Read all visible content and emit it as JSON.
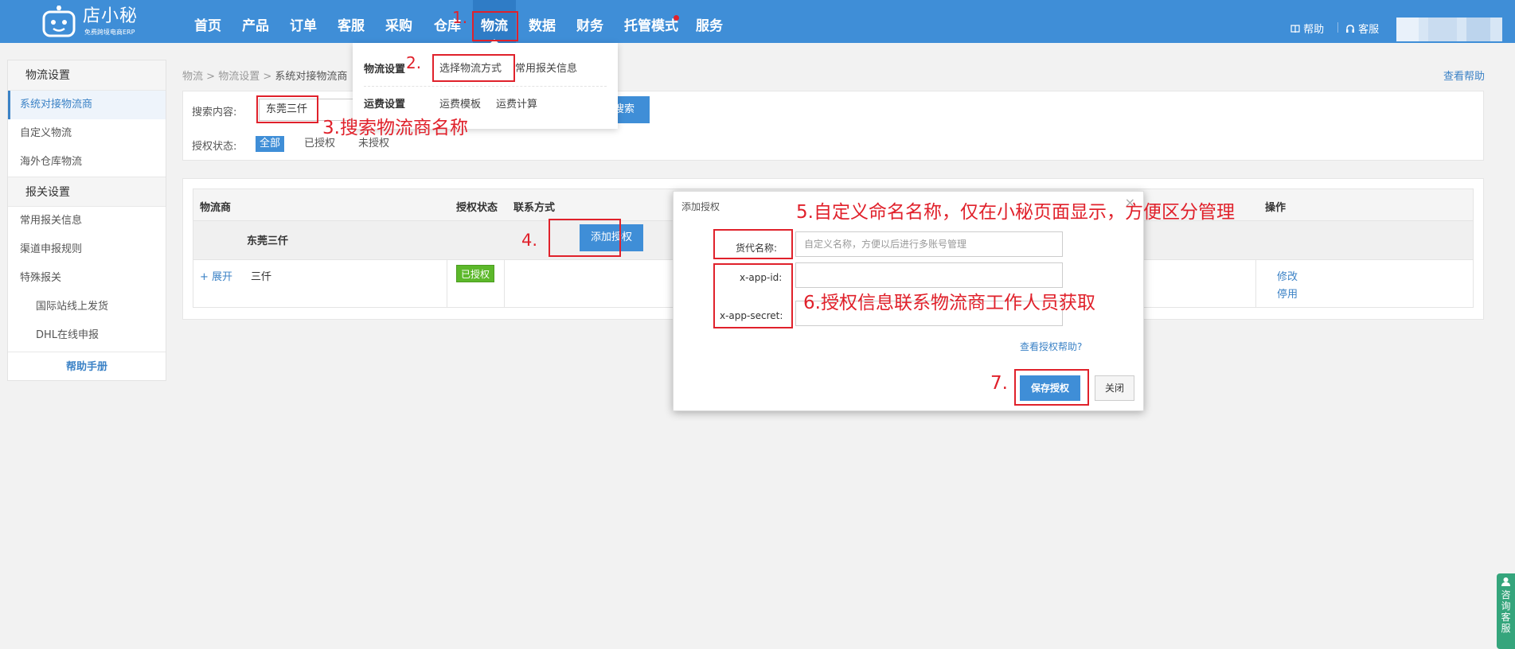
{
  "brand": {
    "name": "店小秘",
    "sub": "免费跨境电商ERP"
  },
  "nav": {
    "items": [
      "首页",
      "产品",
      "订单",
      "客服",
      "采购",
      "仓库",
      "物流",
      "数据",
      "财务",
      "托管模式",
      "服务"
    ],
    "active": "物流",
    "help": "帮助",
    "service": "客服"
  },
  "colors": {
    "topbar": "#3f8ed7",
    "annotation": "#e0212b",
    "badge_authorized": "#5cb82a"
  },
  "sidebar": {
    "sections": [
      {
        "title": "物流设置",
        "items": [
          "系统对接物流商",
          "自定义物流",
          "海外仓库物流"
        ]
      },
      {
        "title": "报关设置",
        "items": [
          "常用报关信息",
          "渠道申报规则",
          "特殊报关"
        ],
        "sub_items": [
          "国际站线上发货",
          "DHL在线申报"
        ]
      }
    ],
    "active_item": "系统对接物流商",
    "help": "帮助手册"
  },
  "breadcrumb": {
    "root": "物流",
    "mid": "物流设置",
    "current": "系统对接物流商",
    "sep": ">"
  },
  "help_link": "查看帮助",
  "search": {
    "label": "搜索内容:",
    "value": "东莞三仟",
    "button": "搜索",
    "status_label": "授权状态:",
    "filters": [
      "全部",
      "已授权",
      "未授权"
    ],
    "active_filter": "全部"
  },
  "table": {
    "columns": [
      "物流商",
      "授权状态",
      "联系方式",
      "操作"
    ],
    "group": {
      "name": "东莞三仟",
      "button": "添加授权"
    },
    "row": {
      "expand": "+ 展开",
      "name": "三仟",
      "status": "已授权",
      "actions": [
        "修改",
        "停用"
      ]
    }
  },
  "dropdown": {
    "groups": [
      {
        "title": "物流设置",
        "items": [
          "选择物流方式",
          "常用报关信息"
        ]
      },
      {
        "title": "运费设置",
        "items": [
          "运费模板",
          "运费计算"
        ]
      }
    ]
  },
  "dialog": {
    "title": "添加授权",
    "close": "×",
    "name_label": "货代名称:",
    "name_placeholder": "自定义名称，方便以后进行多账号管理",
    "app_id_label": "x-app-id:",
    "app_secret_label": "x-app-secret:",
    "help_link": "查看授权帮助?",
    "save": "保存授权",
    "cancel": "关闭"
  },
  "annotations": {
    "step1": "1.",
    "step2": "2.",
    "step3": "3.搜索物流商名称",
    "step4": "4.",
    "step5": "5.自定义命名名称，仅在小秘页面显示，方便区分管理",
    "step6": "6.授权信息联系物流商工作人员获取",
    "step7": "7."
  },
  "consult": "咨询客服"
}
